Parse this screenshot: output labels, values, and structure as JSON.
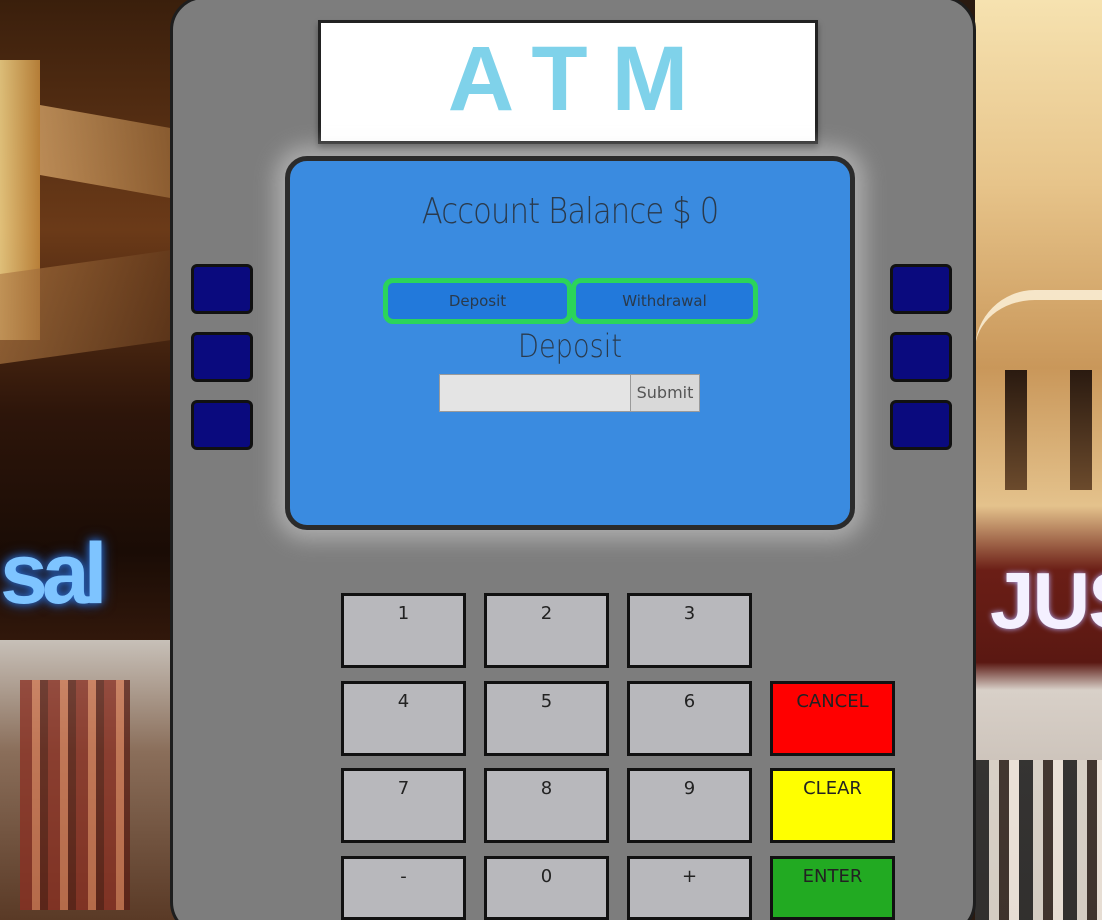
{
  "header": {
    "title": "ATM"
  },
  "screen": {
    "balance_label": "Account Balance $",
    "balance_value": "0",
    "modes": {
      "deposit_label": "Deposit",
      "withdrawal_label": "Withdrawal"
    },
    "active_section_title": "Deposit",
    "amount_input": {
      "value": "",
      "placeholder": ""
    },
    "submit_label": "Submit"
  },
  "keypad": {
    "digits": [
      "1",
      "2",
      "3",
      "4",
      "5",
      "6",
      "7",
      "8",
      "9",
      "-",
      "0",
      "+"
    ],
    "cancel_label": "CANCEL",
    "clear_label": "CLEAR",
    "enter_label": "ENTER"
  },
  "background": {
    "left_sign": "sal",
    "right_sign": "JUS"
  },
  "colors": {
    "title_text": "#7fd2ea",
    "screen": "#3a8be0",
    "mode_button_border": "#2bd45a",
    "side_key": "#0a0a7e",
    "cancel": "#ff0000",
    "clear": "#ffff00",
    "enter": "#22aa22"
  }
}
